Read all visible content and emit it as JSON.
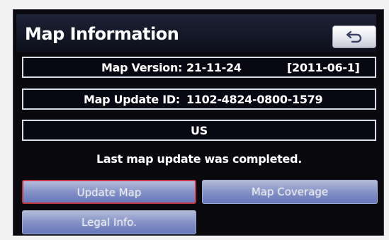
{
  "header": {
    "title": "Map Information",
    "back_icon": "return-arrow-icon"
  },
  "info": {
    "version_label": "Map Version:",
    "version_value": "21-11-24",
    "version_date": "[2011-06-1]",
    "update_id_label": "Map Update ID:",
    "update_id_value": "1102-4824-0800-1579",
    "region": "US"
  },
  "status": "Last map update was completed.",
  "buttons": {
    "update_map": "Update Map",
    "map_coverage": "Map Coverage",
    "legal_info": "Legal Info."
  },
  "colors": {
    "screen_bg": "#0a0a0e",
    "button": "#8f9ed8",
    "selected_border": "#d23a4a",
    "text": "#ffffff"
  }
}
